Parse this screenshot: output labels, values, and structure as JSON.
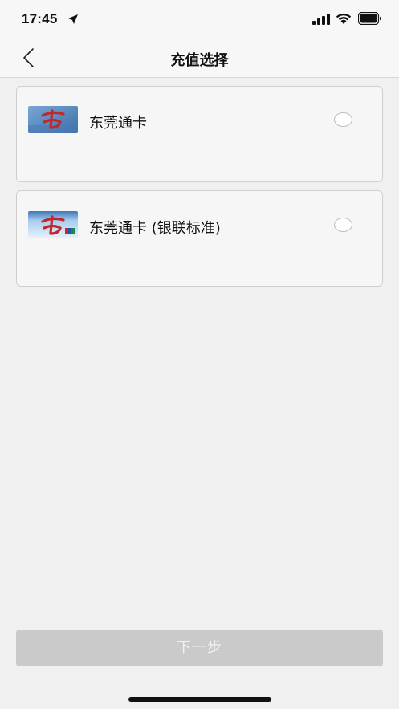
{
  "status_bar": {
    "time": "17:45",
    "icons": [
      "location-arrow-icon",
      "cellular-signal-icon",
      "wifi-icon",
      "battery-icon"
    ]
  },
  "nav": {
    "title": "充值选择",
    "back_icon": "chevron-left-icon"
  },
  "options": [
    {
      "label": "东莞通卡",
      "selected": false
    },
    {
      "label": "东莞通卡 (银联标准)",
      "selected": false
    }
  ],
  "footer": {
    "next_label": "下一步",
    "enabled": false
  },
  "colors": {
    "background": "#f0f0f0",
    "card_background": "#f6f6f6",
    "disabled_button": "#cacaca",
    "card_red": "#c0282c",
    "card_blue": "#5b8fc4"
  }
}
